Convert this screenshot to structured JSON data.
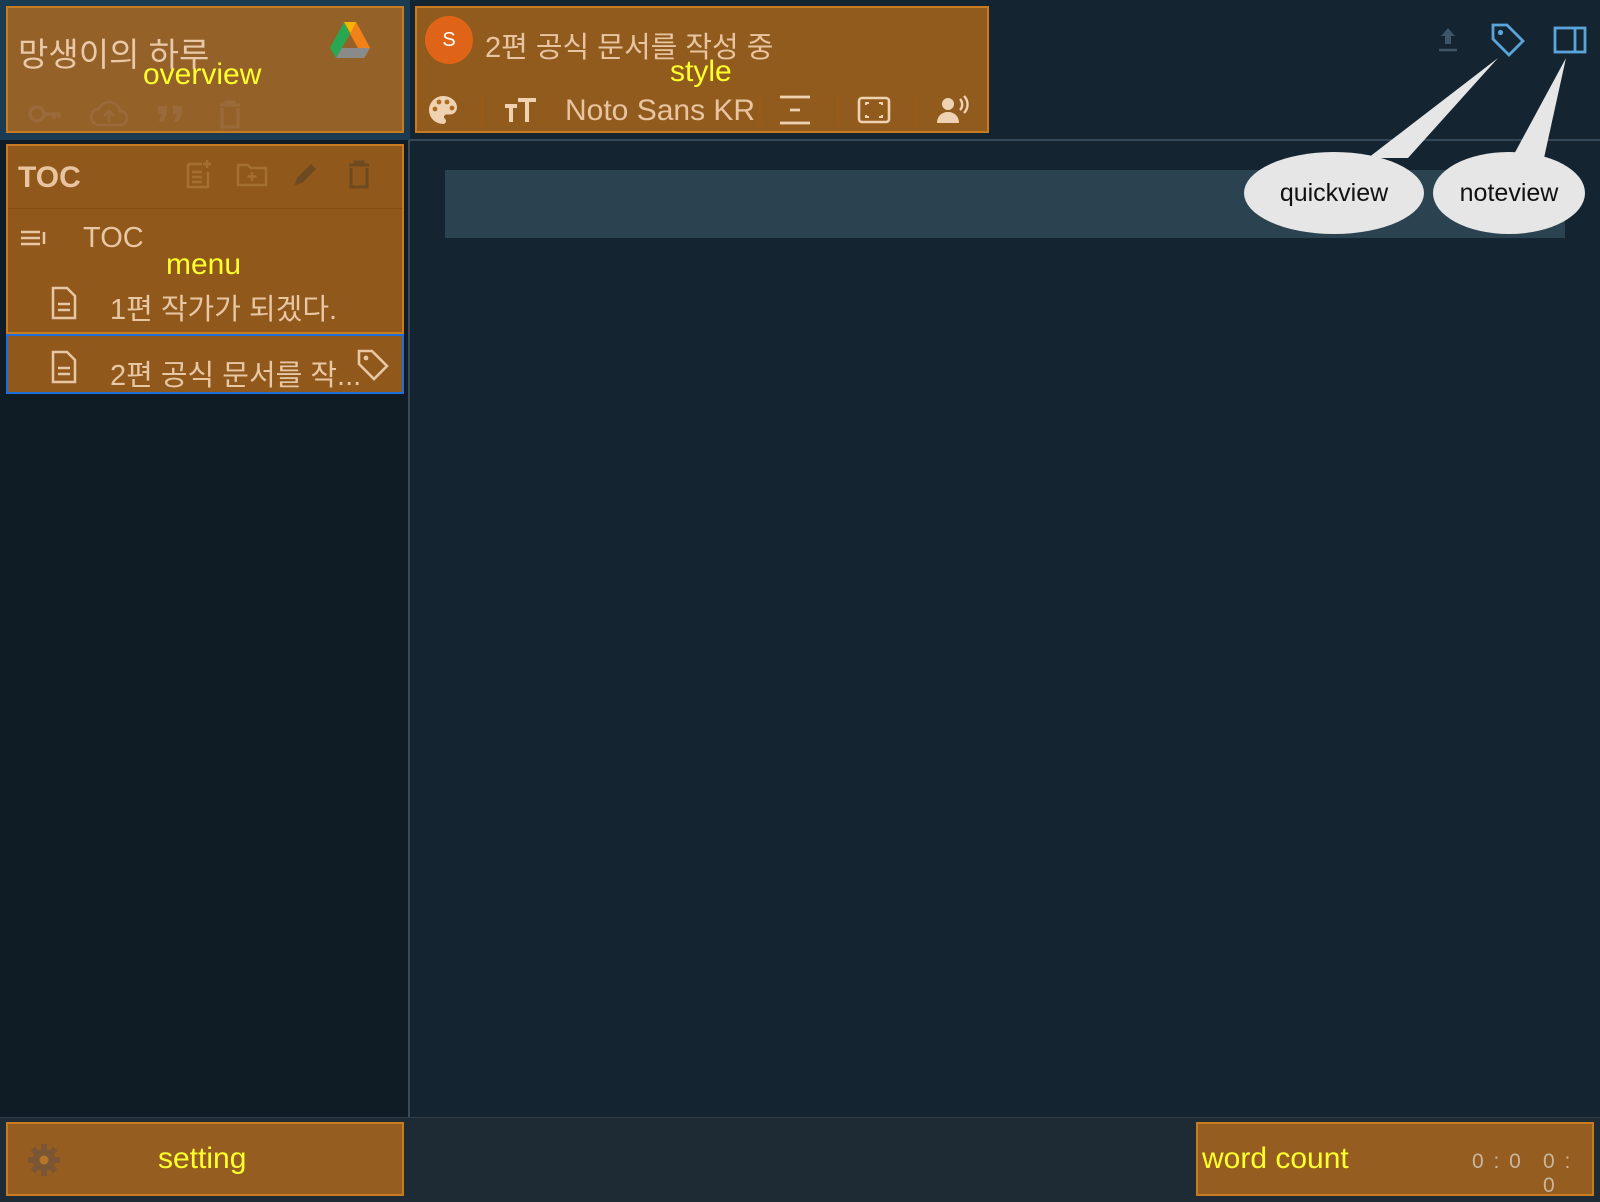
{
  "colors": {
    "app_background": "#142431",
    "sidebar_background": "#0f1c25",
    "highlight_overlay": "#c47018",
    "highlight_label": "#ffff2e",
    "active_border": "#1e6fd8",
    "accent_icon": "#5aa4dc",
    "avatar": "#e06418"
  },
  "overview": {
    "book_title": "망생이의 하루",
    "label": "overview",
    "icons": [
      "drive-logo-icon",
      "key-icon",
      "cloud-upload-icon",
      "quote-icon",
      "trash-icon"
    ]
  },
  "toc": {
    "title": "TOC",
    "label": "menu",
    "tool_icons": [
      "add-note-icon",
      "add-folder-icon",
      "edit-pencil-icon",
      "trash-icon"
    ],
    "root_label": "TOC",
    "items": [
      {
        "label": "1편 작가가 되겠다.",
        "icon": "document-icon"
      },
      {
        "label": "2편 공식 문서를 작...",
        "icon": "document-icon",
        "selected": true,
        "tag_icon": "tag-icon"
      }
    ]
  },
  "style": {
    "avatar_letter": "S",
    "doc_title": "2편 공식 문서를 작성 중",
    "label": "style",
    "font_name": "Noto Sans KR",
    "icons": [
      "palette-icon",
      "font-size-icon",
      "line-spacing-icon",
      "margin-icon",
      "tts-icon"
    ]
  },
  "top_right": {
    "icons": [
      "export-icon",
      "tag-icon",
      "panel-icon"
    ]
  },
  "callouts": {
    "quickview": "quickview",
    "noteview": "noteview"
  },
  "bottom": {
    "setting_label": "setting",
    "wordcount_label": "word count",
    "count_a": "0 : 0",
    "count_b": "0 : 0"
  }
}
